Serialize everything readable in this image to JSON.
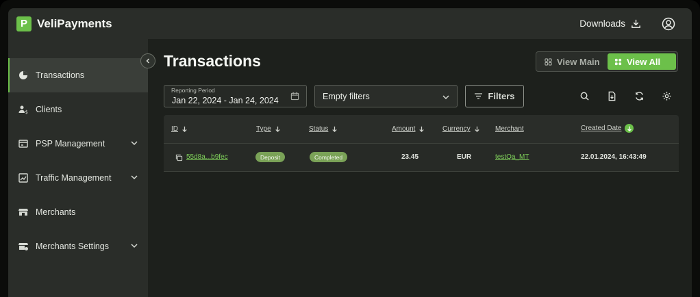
{
  "header": {
    "brand": "VeliPayments",
    "logo_glyph": "P",
    "downloads_label": "Downloads"
  },
  "sidebar": {
    "items": [
      {
        "label": "Transactions",
        "icon": "pie-chart-icon",
        "active": true
      },
      {
        "label": "Clients",
        "icon": "clients-icon"
      },
      {
        "label": "PSP Management",
        "icon": "psp-icon",
        "expandable": true
      },
      {
        "label": "Traffic Management",
        "icon": "traffic-chart-icon",
        "expandable": true
      },
      {
        "label": "Merchants",
        "icon": "store-icon"
      },
      {
        "label": "Merchants Settings",
        "icon": "store-settings-icon",
        "expandable": true
      }
    ]
  },
  "main": {
    "title": "Transactions",
    "view_main_label": "View Main",
    "view_all_label": "View All",
    "reporting_period_label": "Reporting Period",
    "reporting_period_value": "Jan 22, 2024 - Jan 24, 2024",
    "filter_select_value": "Empty filters",
    "filters_button_label": "Filters"
  },
  "table": {
    "columns": [
      "ID",
      "Type",
      "Status",
      "Amount",
      "Currency",
      "Merchant",
      "Created Date"
    ],
    "rows": [
      {
        "id": "55d8a...b9fec",
        "type": "Deposit",
        "status": "Completed",
        "amount": "23.45",
        "currency": "EUR",
        "merchant": "testQa_MT",
        "created": "22.01.2024, 16:43:49"
      }
    ]
  },
  "colors": {
    "accent": "#6cc04a",
    "sidebar_bg": "#2a2d29",
    "content_bg": "#1d201c"
  }
}
